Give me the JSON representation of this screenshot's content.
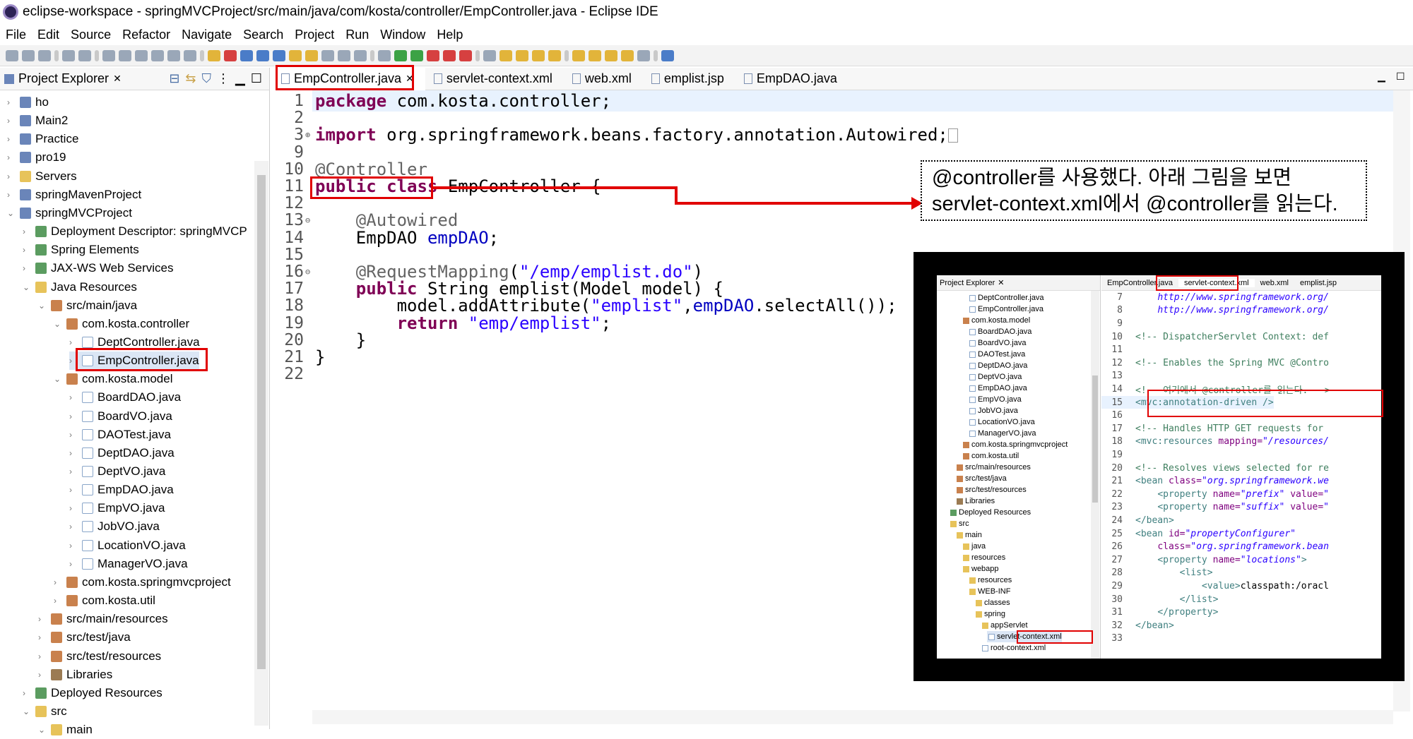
{
  "window": {
    "title": "eclipse-workspace - springMVCProject/src/main/java/com/kosta/controller/EmpController.java - Eclipse IDE"
  },
  "menu": [
    "File",
    "Edit",
    "Source",
    "Refactor",
    "Navigate",
    "Search",
    "Project",
    "Run",
    "Window",
    "Help"
  ],
  "explorer": {
    "title": "Project Explorer",
    "items": [
      {
        "label": "ho",
        "depth": 0,
        "icon": "proj"
      },
      {
        "label": "Main2",
        "depth": 0,
        "icon": "proj"
      },
      {
        "label": "Practice",
        "depth": 0,
        "icon": "proj"
      },
      {
        "label": "pro19",
        "depth": 0,
        "icon": "proj"
      },
      {
        "label": "Servers",
        "depth": 0,
        "icon": "fold"
      },
      {
        "label": "springMavenProject",
        "depth": 0,
        "icon": "proj"
      },
      {
        "label": "springMVCProject",
        "depth": 0,
        "icon": "proj",
        "open": true
      },
      {
        "label": "Deployment Descriptor: springMVCP",
        "depth": 1,
        "icon": "web"
      },
      {
        "label": "Spring Elements",
        "depth": 1,
        "icon": "web"
      },
      {
        "label": "JAX-WS Web Services",
        "depth": 1,
        "icon": "web"
      },
      {
        "label": "Java Resources",
        "depth": 1,
        "icon": "fold",
        "open": true
      },
      {
        "label": "src/main/java",
        "depth": 2,
        "icon": "pkg",
        "open": true
      },
      {
        "label": "com.kosta.controller",
        "depth": 3,
        "icon": "pkg",
        "open": true
      },
      {
        "label": "DeptController.java",
        "depth": 4,
        "icon": "java"
      },
      {
        "label": "EmpController.java",
        "depth": 4,
        "icon": "java",
        "selected": true
      },
      {
        "label": "com.kosta.model",
        "depth": 3,
        "icon": "pkg",
        "open": true
      },
      {
        "label": "BoardDAO.java",
        "depth": 4,
        "icon": "java"
      },
      {
        "label": "BoardVO.java",
        "depth": 4,
        "icon": "java"
      },
      {
        "label": "DAOTest.java",
        "depth": 4,
        "icon": "java"
      },
      {
        "label": "DeptDAO.java",
        "depth": 4,
        "icon": "java"
      },
      {
        "label": "DeptVO.java",
        "depth": 4,
        "icon": "java"
      },
      {
        "label": "EmpDAO.java",
        "depth": 4,
        "icon": "java"
      },
      {
        "label": "EmpVO.java",
        "depth": 4,
        "icon": "java"
      },
      {
        "label": "JobVO.java",
        "depth": 4,
        "icon": "java"
      },
      {
        "label": "LocationVO.java",
        "depth": 4,
        "icon": "java"
      },
      {
        "label": "ManagerVO.java",
        "depth": 4,
        "icon": "java"
      },
      {
        "label": "com.kosta.springmvcproject",
        "depth": 3,
        "icon": "pkg"
      },
      {
        "label": "com.kosta.util",
        "depth": 3,
        "icon": "pkg"
      },
      {
        "label": "src/main/resources",
        "depth": 2,
        "icon": "pkg"
      },
      {
        "label": "src/test/java",
        "depth": 2,
        "icon": "pkg"
      },
      {
        "label": "src/test/resources",
        "depth": 2,
        "icon": "pkg"
      },
      {
        "label": "Libraries",
        "depth": 2,
        "icon": "lib"
      },
      {
        "label": "Deployed Resources",
        "depth": 1,
        "icon": "web"
      },
      {
        "label": "src",
        "depth": 1,
        "icon": "fold",
        "open": true
      },
      {
        "label": "main",
        "depth": 2,
        "icon": "fold",
        "open": true
      }
    ]
  },
  "editor": {
    "tabs": [
      "EmpController.java",
      "servlet-context.xml",
      "web.xml",
      "emplist.jsp",
      "EmpDAO.java"
    ],
    "lines": [
      {
        "n": "1",
        "marker": "",
        "html": "<span class=\"kw\">package</span> com.kosta.controller;"
      },
      {
        "n": "2",
        "marker": "",
        "html": ""
      },
      {
        "n": "3",
        "marker": "⊕",
        "html": "<span class=\"kw\">import</span> org.springframework.beans.factory.annotation.Autowired;<span style=\"border:1px solid #999;display:inline-block;width:14px;height:20px;vertical-align:middle\"></span>"
      },
      {
        "n": "9",
        "marker": "",
        "html": ""
      },
      {
        "n": "10",
        "marker": "",
        "html": "<span class=\"ann\">@Controller</span>"
      },
      {
        "n": "11",
        "marker": "",
        "html": "<span class=\"kw\">public class</span> EmpController {"
      },
      {
        "n": "12",
        "marker": "",
        "html": ""
      },
      {
        "n": "13",
        "marker": "⊖",
        "html": "    <span class=\"ann\">@Autowired</span>"
      },
      {
        "n": "14",
        "marker": "",
        "html": "    EmpDAO <span class=\"fld\">empDAO</span>;"
      },
      {
        "n": "15",
        "marker": "",
        "html": ""
      },
      {
        "n": "16",
        "marker": "⊖",
        "html": "    <span class=\"ann\">@RequestMapping</span>(<span class=\"str\">\"/emp/emplist.do\"</span>)"
      },
      {
        "n": "17",
        "marker": "",
        "html": "    <span class=\"kw\">public</span> String emplist(Model model) {"
      },
      {
        "n": "18",
        "marker": "",
        "html": "        model.addAttribute(<span class=\"str\">\"emplist\"</span>,<span class=\"fld\">empDAO</span>.selectAll());"
      },
      {
        "n": "19",
        "marker": "",
        "html": "        <span class=\"kw\">return</span> <span class=\"str\">\"emp/emplist\"</span>;"
      },
      {
        "n": "20",
        "marker": "",
        "html": "    }"
      },
      {
        "n": "21",
        "marker": "",
        "html": "}"
      },
      {
        "n": "22",
        "marker": "",
        "html": ""
      }
    ]
  },
  "callout": {
    "line1": "@controller를 사용했다. 아래 그림을 보면",
    "line2": "servlet-context.xml에서 @controller를 읽는다."
  },
  "inset": {
    "explorer_title": "Project Explorer",
    "tree": [
      {
        "label": "DeptController.java",
        "depth": 4,
        "icon": "java"
      },
      {
        "label": "EmpController.java",
        "depth": 4,
        "icon": "java"
      },
      {
        "label": "com.kosta.model",
        "depth": 3,
        "icon": "pkg"
      },
      {
        "label": "BoardDAO.java",
        "depth": 4,
        "icon": "java"
      },
      {
        "label": "BoardVO.java",
        "depth": 4,
        "icon": "java"
      },
      {
        "label": "DAOTest.java",
        "depth": 4,
        "icon": "java"
      },
      {
        "label": "DeptDAO.java",
        "depth": 4,
        "icon": "java"
      },
      {
        "label": "DeptVO.java",
        "depth": 4,
        "icon": "java"
      },
      {
        "label": "EmpDAO.java",
        "depth": 4,
        "icon": "java"
      },
      {
        "label": "EmpVO.java",
        "depth": 4,
        "icon": "java"
      },
      {
        "label": "JobVO.java",
        "depth": 4,
        "icon": "java"
      },
      {
        "label": "LocationVO.java",
        "depth": 4,
        "icon": "java"
      },
      {
        "label": "ManagerVO.java",
        "depth": 4,
        "icon": "java"
      },
      {
        "label": "com.kosta.springmvcproject",
        "depth": 3,
        "icon": "pkg"
      },
      {
        "label": "com.kosta.util",
        "depth": 3,
        "icon": "pkg"
      },
      {
        "label": "src/main/resources",
        "depth": 2,
        "icon": "pkg"
      },
      {
        "label": "src/test/java",
        "depth": 2,
        "icon": "pkg"
      },
      {
        "label": "src/test/resources",
        "depth": 2,
        "icon": "pkg"
      },
      {
        "label": "Libraries",
        "depth": 2,
        "icon": "lib"
      },
      {
        "label": "Deployed Resources",
        "depth": 1,
        "icon": "web"
      },
      {
        "label": "src",
        "depth": 1,
        "icon": "fold"
      },
      {
        "label": "main",
        "depth": 2,
        "icon": "fold"
      },
      {
        "label": "java",
        "depth": 3,
        "icon": "fold"
      },
      {
        "label": "resources",
        "depth": 3,
        "icon": "fold"
      },
      {
        "label": "webapp",
        "depth": 3,
        "icon": "fold"
      },
      {
        "label": "resources",
        "depth": 4,
        "icon": "fold"
      },
      {
        "label": "WEB-INF",
        "depth": 4,
        "icon": "fold"
      },
      {
        "label": "classes",
        "depth": 5,
        "icon": "fold"
      },
      {
        "label": "spring",
        "depth": 5,
        "icon": "fold"
      },
      {
        "label": "appServlet",
        "depth": 6,
        "icon": "fold"
      },
      {
        "label": "servlet-context.xml",
        "depth": 7,
        "icon": "java",
        "selected": true
      },
      {
        "label": "root-context.xml",
        "depth": 6,
        "icon": "java"
      }
    ],
    "tabs": [
      "EmpController.java",
      "servlet-context.xml",
      "web.xml",
      "emplist.jsp"
    ],
    "lines": [
      {
        "n": "7",
        "html": "    <span class=\"atv\">http://www.springframework.org/</span>"
      },
      {
        "n": "8",
        "html": "    <span class=\"atv\">http://www.springframework.org/</span>"
      },
      {
        "n": "9",
        "html": ""
      },
      {
        "n": "10",
        "html": "<span class=\"cm\">&lt;!-- DispatcherServlet Context: def</span>"
      },
      {
        "n": "11",
        "html": ""
      },
      {
        "n": "12",
        "html": "<span class=\"cm\">&lt;!-- Enables the Spring MVC @Contro</span>"
      },
      {
        "n": "13",
        "html": ""
      },
      {
        "n": "14",
        "html": "<span class=\"cm\">&lt;!-- 여기에서 @controller를 읽는다. --&gt;</span>"
      },
      {
        "n": "15",
        "html": "<span class=\"tag\">&lt;mvc:annotation-driven /&gt;</span>"
      },
      {
        "n": "16",
        "html": ""
      },
      {
        "n": "17",
        "html": "<span class=\"cm\">&lt;!-- Handles HTTP GET requests for</span>"
      },
      {
        "n": "18",
        "html": "<span class=\"tag\">&lt;mvc:resources</span> <span class=\"atn\">mapping=</span><span class=\"atv\">\"/resources/</span>"
      },
      {
        "n": "19",
        "html": ""
      },
      {
        "n": "20",
        "html": "<span class=\"cm\">&lt;!-- Resolves views selected for re</span>"
      },
      {
        "n": "21",
        "html": "<span class=\"tag\">&lt;bean</span> <span class=\"atn\">class=</span><span class=\"atv\">\"org.springframework.we</span>"
      },
      {
        "n": "22",
        "html": "    <span class=\"tag\">&lt;property</span> <span class=\"atn\">name=</span><span class=\"atv\">\"prefix\"</span> <span class=\"atn\">value=</span><span class=\"atv\">\"</span>"
      },
      {
        "n": "23",
        "html": "    <span class=\"tag\">&lt;property</span> <span class=\"atn\">name=</span><span class=\"atv\">\"suffix\"</span> <span class=\"atn\">value=</span><span class=\"atv\">\"</span>"
      },
      {
        "n": "24",
        "html": "<span class=\"tag\">&lt;/bean&gt;</span>"
      },
      {
        "n": "25",
        "html": "<span class=\"tag\">&lt;bean</span> <span class=\"atn\">id=</span><span class=\"atv\">\"propertyConfigurer\"</span>"
      },
      {
        "n": "26",
        "html": "    <span class=\"atn\">class=</span><span class=\"atv\">\"org.springframework.bean</span>"
      },
      {
        "n": "27",
        "html": "    <span class=\"tag\">&lt;property</span> <span class=\"atn\">name=</span><span class=\"atv\">\"locations\"</span><span class=\"tag\">&gt;</span>"
      },
      {
        "n": "28",
        "html": "        <span class=\"tag\">&lt;list&gt;</span>"
      },
      {
        "n": "29",
        "html": "            <span class=\"tag\">&lt;value&gt;</span>classpath:/oracl"
      },
      {
        "n": "30",
        "html": "        <span class=\"tag\">&lt;/list&gt;</span>"
      },
      {
        "n": "31",
        "html": "    <span class=\"tag\">&lt;/property&gt;</span>"
      },
      {
        "n": "32",
        "html": "<span class=\"tag\">&lt;/bean&gt;</span>"
      },
      {
        "n": "33",
        "html": ""
      }
    ]
  }
}
